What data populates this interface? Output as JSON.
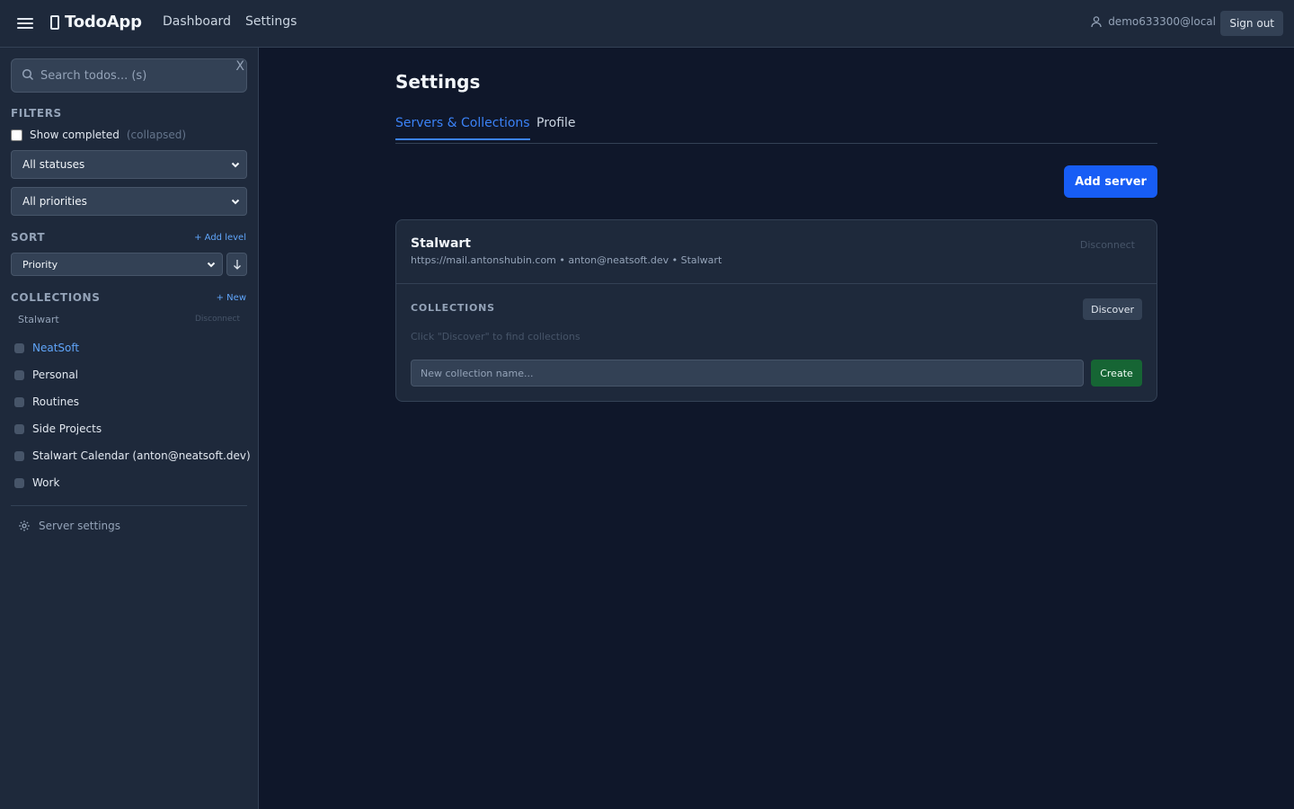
{
  "header": {
    "app_name": "TodoApp",
    "nav": [
      "Dashboard",
      "Settings"
    ],
    "user": "demo633300@local",
    "sign_out": "Sign out"
  },
  "sidebar": {
    "search_placeholder": "Search todos... (s)",
    "search_clear": "X",
    "filters_label": "FILTERS",
    "show_completed": "Show completed",
    "show_completed_note": "(collapsed)",
    "status_select": "All statuses",
    "priority_select": "All priorities",
    "sort_label": "SORT",
    "add_level": "+ Add level",
    "sort_select": "Priority",
    "collections_label": "COLLECTIONS",
    "new_collection": "+ New",
    "server_name": "Stalwart",
    "server_disconnect": "Disconnect",
    "collections": [
      {
        "label": "NeatSoft",
        "active": true
      },
      {
        "label": "Personal",
        "active": false
      },
      {
        "label": "Routines",
        "active": false
      },
      {
        "label": "Side Projects",
        "active": false
      },
      {
        "label": "Stalwart Calendar (anton@neatsoft.dev)",
        "active": false
      },
      {
        "label": "Work",
        "active": false
      }
    ],
    "server_settings": "Server settings"
  },
  "main": {
    "title": "Settings",
    "tabs": [
      "Servers & Collections",
      "Profile"
    ],
    "add_server": "Add server",
    "server_card": {
      "name": "Stalwart",
      "meta": "https://mail.antonshubin.com • anton@neatsoft.dev • Stalwart",
      "disconnect": "Disconnect",
      "collections_title": "COLLECTIONS",
      "discover": "Discover",
      "hint": "Click \"Discover\" to find collections",
      "new_placeholder": "New collection name...",
      "create": "Create"
    }
  },
  "colors": {
    "accent": "#3b82f6",
    "primary_button": "#175df5",
    "create_button": "#166534",
    "background": "#0f172a",
    "panel": "#1e293b"
  }
}
